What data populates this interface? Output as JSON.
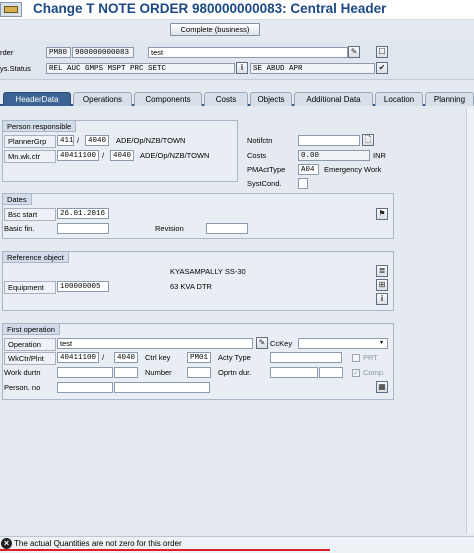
{
  "window": {
    "title": "Change T NOTE ORDER 980000000083: Central Header"
  },
  "header": {
    "order_label": "rder",
    "order_type": "PM80",
    "order_number": "980000000083",
    "order_text": "test",
    "complete_button": "Complete (business)",
    "sysstatus_label": "ys.Status",
    "system_status": "REL  AUC  GMPS MSPT PRC  SETC",
    "user_status": "SE   ABUD APR"
  },
  "tabs": [
    {
      "label": "HeaderData"
    },
    {
      "label": "Operations"
    },
    {
      "label": "Components"
    },
    {
      "label": "Costs"
    },
    {
      "label": "Objects"
    },
    {
      "label": "Additional Data"
    },
    {
      "label": "Location"
    },
    {
      "label": "Planning"
    }
  ],
  "person_responsible": {
    "title": "Person responsible",
    "planner_label": "PlannerGrp",
    "planner_group": "411",
    "planner_plant": "4040",
    "planner_text": "ADE/Op/NZB/TOWN",
    "mnwkctr_label": "Mn.wk.ctr",
    "work_center": "40411100",
    "work_center_plant": "4040",
    "work_center_text": "ADE/Op/NZB/TOWN",
    "slash": "/"
  },
  "right_panel": {
    "notif_label": "Notifctn",
    "notif_value": "",
    "costs_label": "Costs",
    "costs_value": "0.00",
    "currency": "INR",
    "pmact_label": "PMActType",
    "pmact_value": "A04",
    "pmact_text": "Emergency Work",
    "systcond_label": "SystCond.",
    "systcond_value": ""
  },
  "dates": {
    "title": "Dates",
    "bsc_start_label": "Bsc start",
    "bsc_start_value": "26.01.2016",
    "basic_fin_label": "Basic fin.",
    "basic_fin_value": "",
    "revision_label": "Revision",
    "revision_value": ""
  },
  "reference_object": {
    "title": "Reference object",
    "line1": "KYASAMPALLY SS-30",
    "equipment_label": "Equipment",
    "equipment_value": "100000005",
    "equipment_text": "63 KVA DTR"
  },
  "first_operation": {
    "title": "First operation",
    "operation_label": "Operation",
    "operation_value": "test",
    "cckey_label": "CcKey",
    "cckey_value": "",
    "wkctr_label": "WkCtr/Plnt",
    "wkctr_value": "40411100",
    "wkctr_plant": "4040",
    "slash": "/",
    "ctrl_key_label": "Ctrl key",
    "ctrl_key_value": "PM01",
    "acty_type_label": "Acty Type",
    "acty_type_value": "",
    "prt_label": "PRT",
    "work_durtn_label": "Work durtn",
    "number_label": "Number",
    "oprtn_dur_label": "Oprtn dur.",
    "comp_label": "Comp.",
    "person_no_label": "Person. no"
  },
  "status_bar": {
    "message": "The actual Quantities are not zero for this order"
  },
  "colors": {
    "title": "#1c4a86",
    "active_tab": "#3d6394",
    "error_underline": "#d8212a"
  }
}
